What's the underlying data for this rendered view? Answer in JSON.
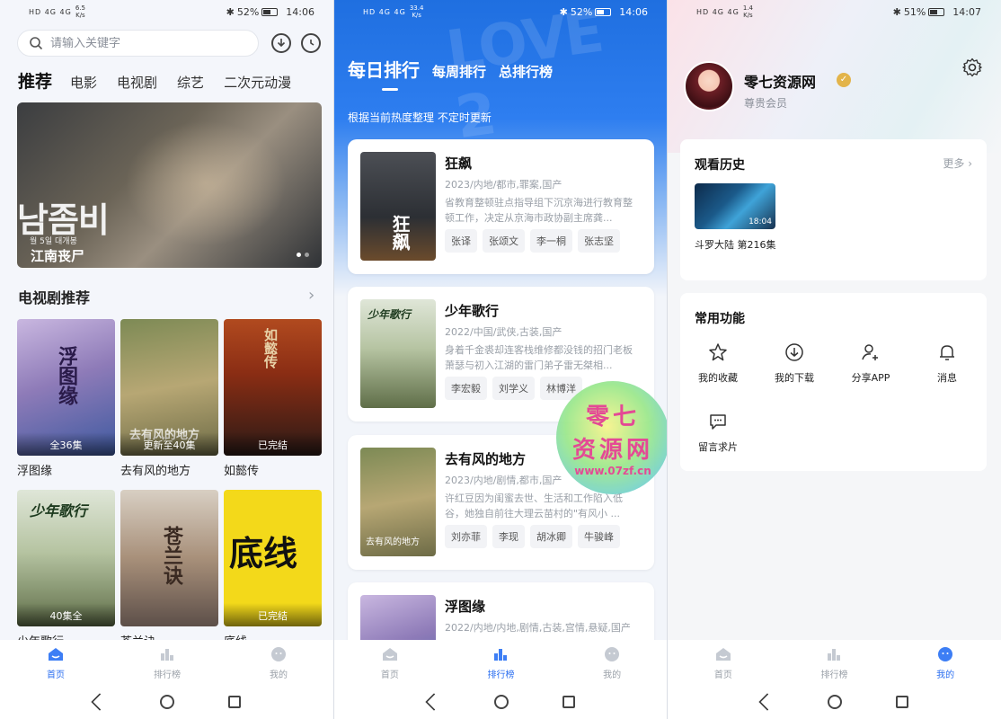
{
  "status": {
    "left": {
      "signal": "HD 4G 4G",
      "speed1": {
        "value": "6.5",
        "unit": "K/s"
      }
    },
    "s1": {
      "bt_batt": "52%",
      "time": "14:06"
    },
    "s2": {
      "speed": {
        "value": "33.4",
        "unit": "K/s"
      },
      "bt_batt": "52%",
      "time": "14:06"
    },
    "s3": {
      "speed": {
        "value": "1.4",
        "unit": "K/s"
      },
      "bt_batt": "51%",
      "time": "14:07"
    }
  },
  "home": {
    "search_placeholder": "请输入关键字",
    "tabs": [
      "推荐",
      "电影",
      "电视剧",
      "综艺",
      "二次元动漫"
    ],
    "banner": {
      "title": "江南丧尸",
      "overlay_text": "남좀비",
      "small_text": "월 5일 대개봉"
    },
    "section_title": "电视剧推荐",
    "cards": [
      {
        "name": "浮图缘",
        "badge": "全36集",
        "poster_text": "浮图缘"
      },
      {
        "name": "去有风的地方",
        "badge": "更新至40集",
        "poster_text": "去有风的地方"
      },
      {
        "name": "如懿传",
        "badge": "已完结",
        "poster_text": "如懿传"
      },
      {
        "name": "少年歌行",
        "badge": "40集全",
        "poster_text": "少年歌行"
      },
      {
        "name": "苍兰诀",
        "badge": "",
        "poster_text": "苍兰诀"
      },
      {
        "name": "底线",
        "badge": "已完结",
        "poster_text": "底线"
      }
    ]
  },
  "bottom_nav": [
    {
      "label": "首页",
      "icon": "home-icon"
    },
    {
      "label": "排行榜",
      "icon": "bar-chart-icon"
    },
    {
      "label": "我的",
      "icon": "face-icon"
    }
  ],
  "rank": {
    "tabs": [
      "每日排行",
      "每周排行",
      "总排行榜"
    ],
    "subtitle": "根据当前热度整理 不定时更新",
    "items": [
      {
        "title": "狂飙",
        "meta": "2023/内地/都市,罪案,国产",
        "desc": "省教育整顿驻点指导组下沉京海进行教育整顿工作，决定从京海市政协副主席龚...",
        "tags": [
          "张译",
          "张颂文",
          "李一桐",
          "张志坚"
        ],
        "poster_text": "狂飙"
      },
      {
        "title": "少年歌行",
        "meta": "2022/中国/武侠,古装,国产",
        "desc": "身着千金裘却连客栈维修都没钱的招门老板萧瑟与初入江湖的雷门弟子雷无桀相...",
        "tags": [
          "李宏毅",
          "刘学义",
          "林博洋"
        ],
        "poster_text": "少年歌行"
      },
      {
        "title": "去有风的地方",
        "meta": "2023/内地/剧情,都市,国产",
        "desc": "许红豆因为闺蜜去世、生活和工作陷入低谷，她独自前往大理云苗村的\"有风小 ...",
        "tags": [
          "刘亦菲",
          "李现",
          "胡冰卿",
          "牛骏峰"
        ],
        "poster_text": "去有风的地方"
      },
      {
        "title": "浮图缘",
        "meta": "2022/内地/内地,剧情,古装,宫情,悬疑,国产",
        "desc": "",
        "tags": [],
        "poster_text": ""
      }
    ]
  },
  "watermark": {
    "line1": "零七",
    "line2": "资源网",
    "url": "www.07zf.cn"
  },
  "profile": {
    "name": "零七资源网",
    "role": "尊贵会员",
    "history_title": "观看历史",
    "more": "更多",
    "history_item": {
      "name": "斗罗大陆 第216集",
      "duration": "18:04"
    },
    "functions_title": "常用功能",
    "functions": [
      {
        "label": "我的收藏",
        "icon": "star-icon"
      },
      {
        "label": "我的下载",
        "icon": "download-icon"
      },
      {
        "label": "分享APP",
        "icon": "share-user-icon"
      },
      {
        "label": "消息",
        "icon": "bell-icon"
      },
      {
        "label": "留言求片",
        "icon": "message-icon"
      }
    ]
  }
}
